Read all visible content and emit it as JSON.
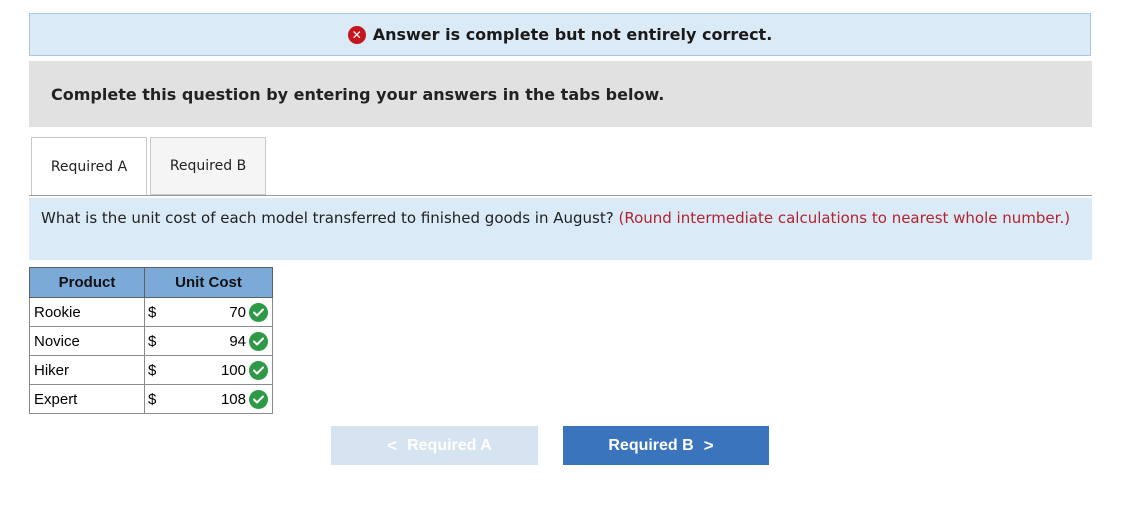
{
  "banner": {
    "icon": "x-circle-icon",
    "icon_glyph": "✕",
    "icon_color": "#c4161c",
    "text": "Answer is complete but not entirely correct."
  },
  "instructions": {
    "text": "Complete this question by entering your answers in the tabs below."
  },
  "tabs": [
    {
      "label": "Required A",
      "active": true
    },
    {
      "label": "Required B",
      "active": false
    }
  ],
  "question": {
    "text": "What is the unit cost of each model transferred to finished goods in August?",
    "note": "(Round intermediate calculations to nearest whole number.)"
  },
  "table": {
    "headers": [
      "Product",
      "Unit Cost"
    ],
    "rows": [
      {
        "product": "Rookie",
        "currency": "$",
        "value": "70",
        "status": "correct"
      },
      {
        "product": "Novice",
        "currency": "$",
        "value": "94",
        "status": "correct"
      },
      {
        "product": "Hiker",
        "currency": "$",
        "value": "100",
        "status": "correct"
      },
      {
        "product": "Expert",
        "currency": "$",
        "value": "108",
        "status": "correct"
      }
    ]
  },
  "nav": {
    "prev_label": "Required A",
    "prev_glyph": "<",
    "next_label": "Required B",
    "next_glyph": ">"
  },
  "colors": {
    "accent": "#3a74bd",
    "banner_bg": "#dbeaf7",
    "note_red": "#b0242f",
    "correct_green": "#2e9a47"
  }
}
